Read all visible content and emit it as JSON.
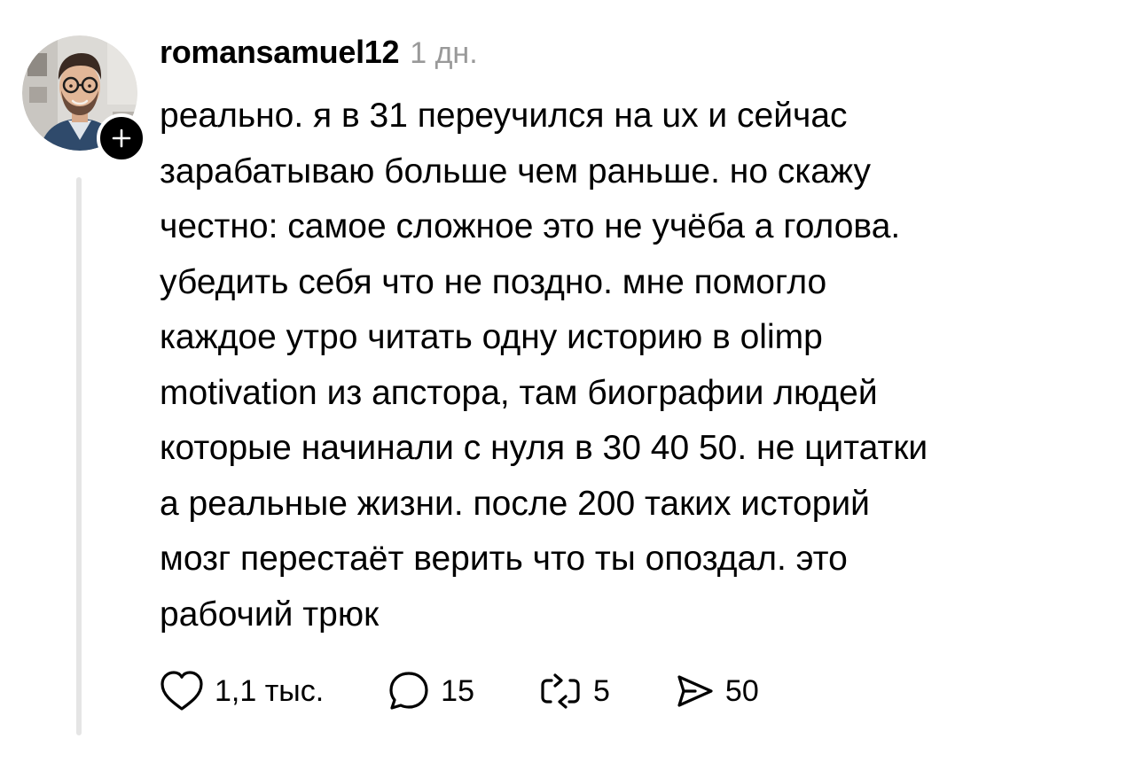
{
  "post": {
    "username": "romansamuel12",
    "timestamp": "1 дн.",
    "text_lines": [
      "реально. я в 31 переучился на ux и сейчас",
      "зарабатываю больше чем раньше. но скажу",
      "честно: самое сложное это не учёба а голова.",
      "убедить себя что не поздно. мне помогло",
      "каждое утро читать одну историю в olimp",
      "motivation из апстора, там биографии людей",
      "которые начинали с нуля в 30 40 50. не цитатки",
      "а реальные жизни. после 200 таких историй",
      "мозг перестаёт верить что ты опоздал. это",
      "рабочий трюк"
    ],
    "avatar": {
      "icon": "user-photo"
    },
    "follow_badge": {
      "icon": "plus-icon"
    }
  },
  "actions": {
    "like": {
      "icon": "heart-icon",
      "count": "1,1 тыс."
    },
    "comment": {
      "icon": "comment-icon",
      "count": "15"
    },
    "repost": {
      "icon": "repost-icon",
      "count": "5"
    },
    "share": {
      "icon": "send-icon",
      "count": "50"
    }
  },
  "colors": {
    "text": "#000000",
    "muted": "#999999",
    "thread_line": "#e5e5e5",
    "background": "#ffffff"
  }
}
